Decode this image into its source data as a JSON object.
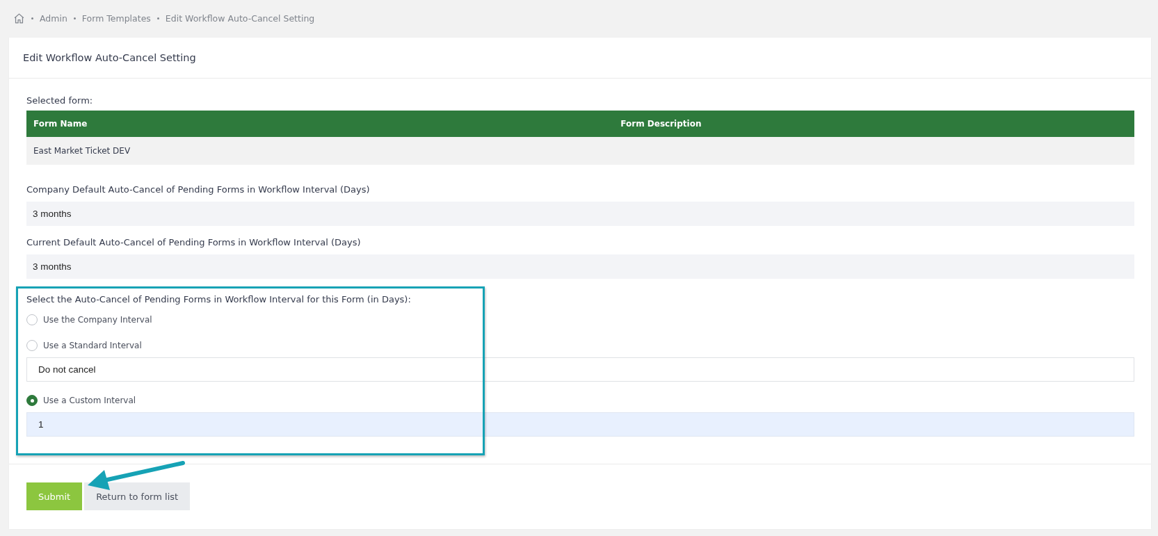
{
  "breadcrumb": [
    "Admin",
    "Form Templates",
    "Edit Workflow Auto-Cancel Setting"
  ],
  "card": {
    "title": "Edit Workflow Auto-Cancel Setting"
  },
  "selected_form": {
    "label": "Selected form:",
    "table": {
      "columns": [
        "Form Name",
        "Form Description"
      ],
      "rows": [
        [
          "East Market Ticket DEV",
          ""
        ]
      ]
    }
  },
  "readonly_fields": [
    {
      "label": "Company Default Auto-Cancel of Pending Forms in Workflow Interval (Days)",
      "value": "3 months"
    },
    {
      "label": "Current Default Auto-Cancel of Pending Forms in Workflow Interval (Days)",
      "value": "3 months"
    }
  ],
  "interval_choice": {
    "label": "Select the Auto-Cancel of Pending Forms in Workflow Interval for this Form (in Days):",
    "options": [
      {
        "label": "Use the Company Interval",
        "selected": false
      },
      {
        "label": "Use a Standard Interval",
        "selected": false,
        "field": {
          "kind": "select",
          "value": "Do not cancel"
        }
      },
      {
        "label": "Use a Custom Interval",
        "selected": true,
        "field": {
          "kind": "input",
          "value": "1"
        }
      }
    ]
  },
  "buttons": [
    {
      "label": "Submit",
      "kind": "primary"
    },
    {
      "label": "Return to form list",
      "kind": "secondary"
    }
  ]
}
